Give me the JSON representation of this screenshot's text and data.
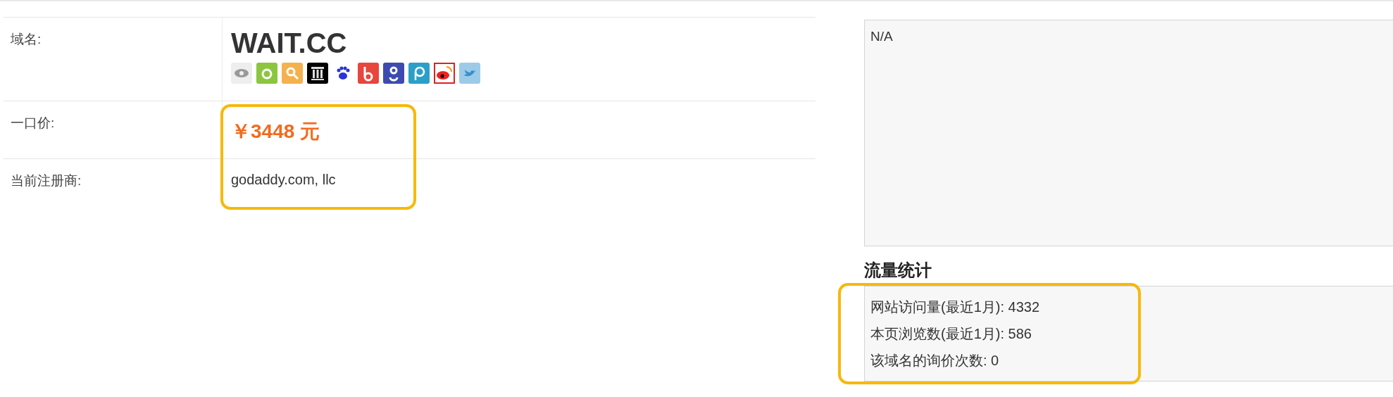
{
  "domain_table": {
    "rows": [
      {
        "kind": "domain",
        "label": "域名:",
        "value": "WAIT.CC"
      },
      {
        "kind": "price",
        "label": "一口价:",
        "value": "￥3448 元"
      },
      {
        "kind": "text",
        "label": "当前注册商:",
        "value": "godaddy.com, llc"
      }
    ]
  },
  "description": {
    "text": "N/A"
  },
  "traffic": {
    "title": "流量统计",
    "lines": [
      "网站访问量(最近1月): 4332",
      "本页浏览数(最近1月): 586",
      "该域名的询价次数: 0"
    ]
  }
}
